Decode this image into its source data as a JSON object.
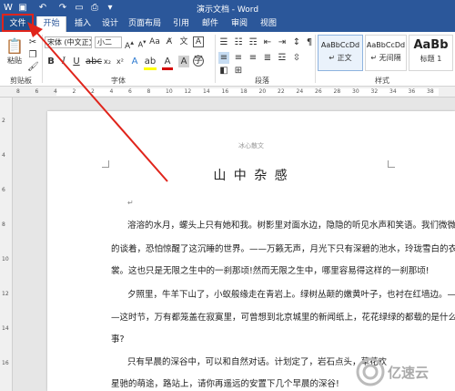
{
  "window": {
    "title": "演示文档 - Word"
  },
  "quick_access": {
    "icons": [
      "save-icon",
      "undo-icon",
      "redo-icon",
      "open-icon",
      "print-icon"
    ]
  },
  "tabs": [
    {
      "label": "文件"
    },
    {
      "label": "开始"
    },
    {
      "label": "插入"
    },
    {
      "label": "设计"
    },
    {
      "label": "页面布局"
    },
    {
      "label": "引用"
    },
    {
      "label": "邮件"
    },
    {
      "label": "审阅"
    },
    {
      "label": "视图"
    }
  ],
  "ribbon": {
    "clipboard": {
      "paste_label": "粘贴",
      "group_label": "剪贴板"
    },
    "font": {
      "font_name": "宋体 (中文正文)",
      "font_size": "小二",
      "group_label": "字体"
    },
    "paragraph": {
      "group_label": "段落"
    },
    "styles": {
      "group_label": "样式",
      "cards": [
        {
          "sample": "AaBbCcDd",
          "name": "↵ 正文"
        },
        {
          "sample": "AaBbCcDd",
          "name": "↵ 无间隔"
        },
        {
          "sample": "AaBb",
          "name": "标题 1"
        }
      ]
    }
  },
  "ruler": {
    "ticks": [
      "8",
      "6",
      "4",
      "2",
      "2",
      "4",
      "6",
      "8",
      "10",
      "12",
      "14",
      "16",
      "18",
      "20",
      "22",
      "24",
      "26",
      "28",
      "30",
      "32",
      "34",
      "36",
      "38"
    ]
  },
  "vruler": {
    "ticks": [
      "2",
      "4",
      "6",
      "8",
      "10",
      "12",
      "14",
      "16"
    ]
  },
  "document": {
    "header": "冰心散文",
    "title": "山 中 杂 感",
    "lines": [
      "溶溶的水月，螺头上只有她和我。树影里对面水边，隐隐的听见水声和笑语。我们微微",
      "的谈着，恐怕惊醒了这沉睡的世界。——万籁无声，月光下只有深碧的池水，玲珑雪白的衣",
      "裳。这也只是无限之生中的一刹那顷!然而无限之生中，哪里容易得这样的一刹那顷!",
      "夕照里，牛羊下山了，小蚁般缘走在青岩上。绿树丛颠的嫩黄叶子，也衬在红墙边。—",
      "—这时节，万有都笼盖在寂寞里，可曾想到北京城里的新闻纸上，花花绿绿的都载的是什么",
      "事?",
      "只有早晨的深谷中，可以和自然对话。计划定了，岩石点头，草花欢",
      "星驰的萌途，路站上，请你再遥远的安置下几个早晨的深谷!"
    ]
  },
  "watermark": {
    "text": "亿速云"
  },
  "colors": {
    "word_blue": "#2b579a",
    "highlight_red": "#e0241b",
    "font_color_red": "#d40000",
    "highlighter_yellow": "#ffff00"
  }
}
